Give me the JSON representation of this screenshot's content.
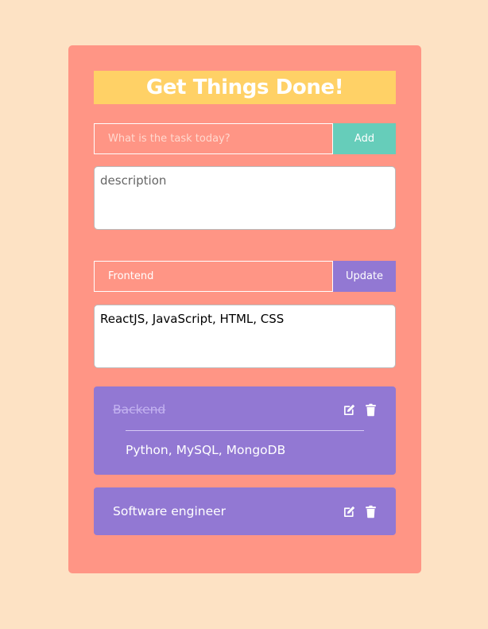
{
  "header": {
    "title": "Get Things Done!"
  },
  "new_task": {
    "placeholder": "What is the task today?",
    "value": "",
    "add_label": "Add",
    "description_placeholder": "description",
    "description_value": ""
  },
  "edit_task": {
    "value": "Frontend",
    "update_label": "Update",
    "description_value": "ReactJS, JavaScript, HTML, CSS"
  },
  "tasks": [
    {
      "title": "Backend",
      "completed": true,
      "description": "Python, MySQL, MongoDB",
      "icons": [
        "edit-icon",
        "trash-icon"
      ]
    },
    {
      "title": "Software engineer",
      "completed": false,
      "description": "",
      "icons": [
        "edit-icon",
        "trash-icon"
      ]
    }
  ],
  "colors": {
    "page_bg": "#fde2c4",
    "panel_bg": "#ff9585",
    "title_bg": "#ffd166",
    "add_button": "#66cdba",
    "update_button": "#9278d3",
    "task_card": "#9278d3",
    "completed_text": "#c3b2f0"
  }
}
